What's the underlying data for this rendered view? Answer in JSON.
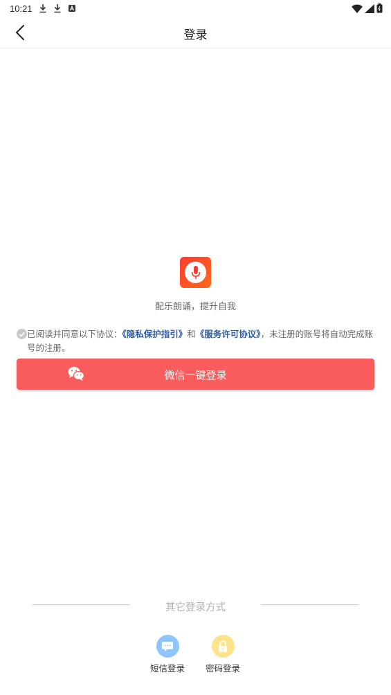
{
  "status_bar": {
    "time": "10:21",
    "left_icons": [
      "download-icon",
      "download-icon",
      "a-icon"
    ],
    "right_icons": [
      "wifi-icon",
      "signal-icon",
      "battery-icon"
    ]
  },
  "header": {
    "title": "登录",
    "back_icon": "chevron-left-icon"
  },
  "app": {
    "logo_icon": "microphone-icon",
    "slogan": "配乐朗诵，提升自我",
    "colors": {
      "brand_gradient_start": "#ff3b30",
      "brand_gradient_end": "#ff6a1a"
    }
  },
  "agreement": {
    "prefix": "已阅读并同意以下协议：",
    "privacy_link": "《隐私保护指引》",
    "and": "和",
    "service_link": "《服务许可协议》",
    "suffix": "，未注册的账号将自动完成账号的注册。",
    "check_icon": "check-circle-icon",
    "colors": {
      "link": "#2c5aa0"
    }
  },
  "wechat_login": {
    "label": "微信一键登录",
    "icon": "wechat-icon",
    "colors": {
      "button": "#f85c5c"
    }
  },
  "other_login": {
    "title": "其它登录方式",
    "options": [
      {
        "label": "短信登录",
        "icon": "message-icon",
        "color": "#8ec5ff"
      },
      {
        "label": "密码登录",
        "icon": "lock-icon",
        "color": "#ffe38a"
      }
    ]
  }
}
